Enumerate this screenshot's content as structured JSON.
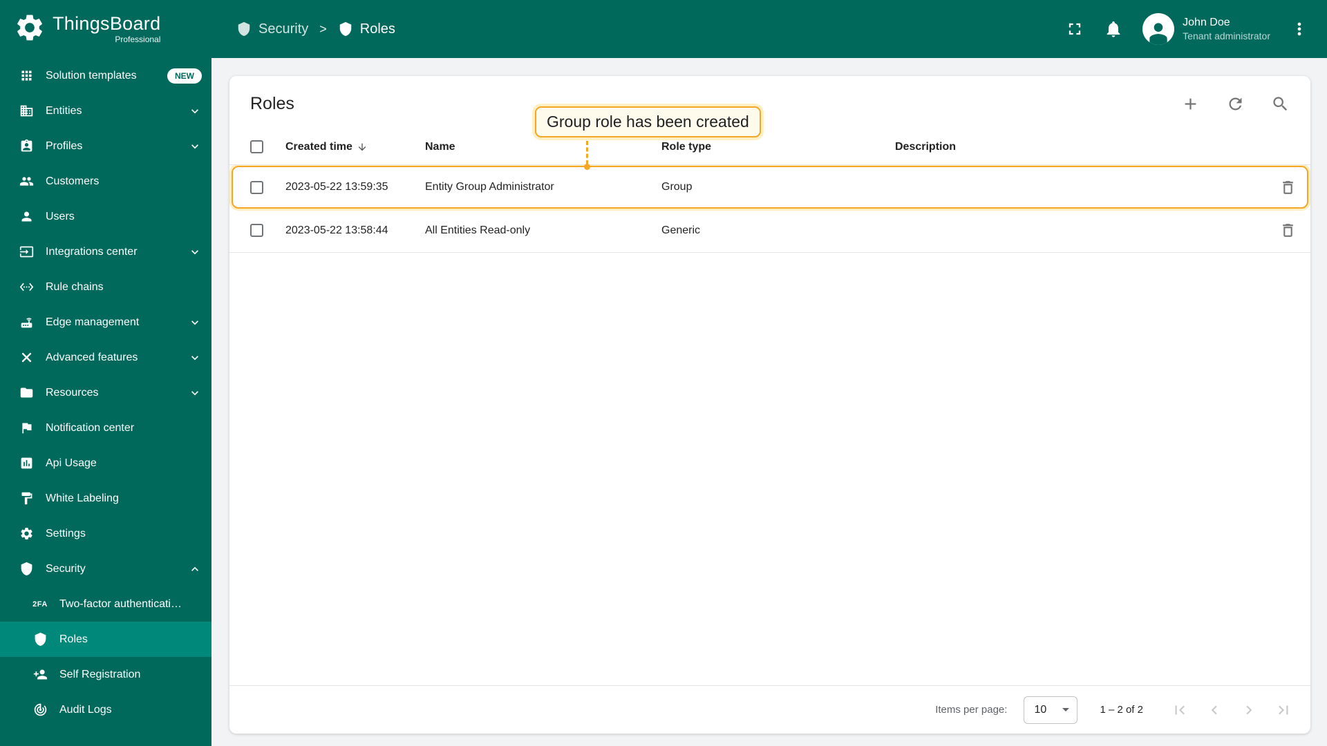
{
  "app": {
    "name": "ThingsBoard",
    "edition": "Professional"
  },
  "header": {
    "breadcrumb": [
      {
        "label": "Security"
      },
      {
        "label": "Roles"
      }
    ],
    "separator": ">",
    "user": {
      "name": "John Doe",
      "role": "Tenant administrator"
    }
  },
  "sidebar": {
    "items": [
      {
        "label": "Solution templates",
        "icon": "grid",
        "badge": "NEW"
      },
      {
        "label": "Entities",
        "icon": "domain",
        "expandable": true
      },
      {
        "label": "Profiles",
        "icon": "profiles",
        "expandable": true
      },
      {
        "label": "Customers",
        "icon": "people"
      },
      {
        "label": "Users",
        "icon": "person"
      },
      {
        "label": "Integrations center",
        "icon": "input",
        "expandable": true
      },
      {
        "label": "Rule chains",
        "icon": "ethernet"
      },
      {
        "label": "Edge management",
        "icon": "router",
        "expandable": true
      },
      {
        "label": "Advanced features",
        "icon": "tools",
        "expandable": true
      },
      {
        "label": "Resources",
        "icon": "folder",
        "expandable": true
      },
      {
        "label": "Notification center",
        "icon": "flag"
      },
      {
        "label": "Api Usage",
        "icon": "chart"
      },
      {
        "label": "White Labeling",
        "icon": "paint"
      },
      {
        "label": "Settings",
        "icon": "gear"
      },
      {
        "label": "Security",
        "icon": "shield",
        "expandable": true,
        "expanded": true
      }
    ],
    "security_subitems": [
      {
        "label": "Two-factor authenticati…",
        "icon": "tfa"
      },
      {
        "label": "Roles",
        "icon": "shield",
        "active": true
      },
      {
        "label": "Self Registration",
        "icon": "person-add"
      },
      {
        "label": "Audit Logs",
        "icon": "track-changes"
      }
    ]
  },
  "main": {
    "title": "Roles",
    "tooltip": "Group role has been created",
    "table": {
      "columns": [
        "Created time",
        "Name",
        "Role type",
        "Description"
      ],
      "rows": [
        {
          "created_time": "2023-05-22 13:59:35",
          "name": "Entity Group Administrator",
          "role_type": "Group",
          "description": "",
          "highlighted": true
        },
        {
          "created_time": "2023-05-22 13:58:44",
          "name": "All Entities Read-only",
          "role_type": "Generic",
          "description": "",
          "highlighted": false
        }
      ]
    },
    "pagination": {
      "items_per_page_label": "Items per page:",
      "items_per_page": "10",
      "range": "1 – 2 of 2"
    }
  },
  "colors": {
    "primary": "#00695c",
    "active_item": "#00897b",
    "highlight": "#f5a623",
    "page_bg": "#f1f3f4"
  }
}
